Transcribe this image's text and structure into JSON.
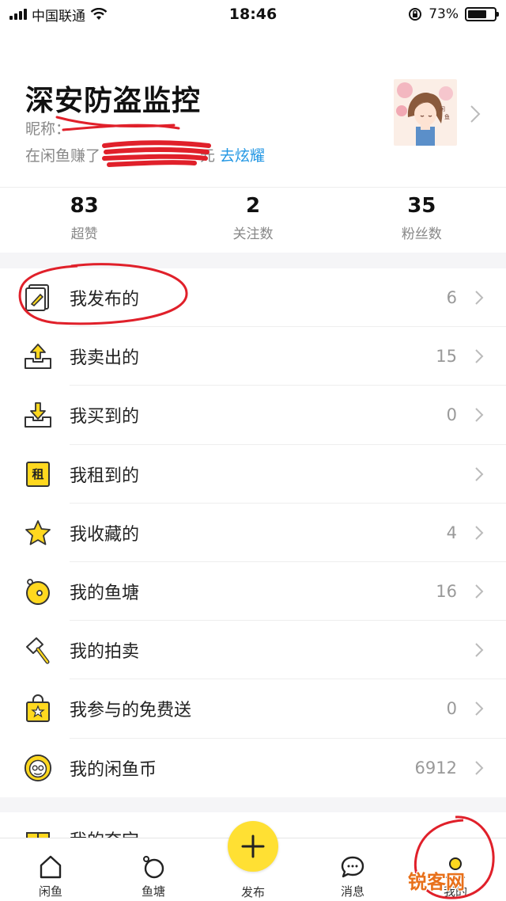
{
  "status_bar": {
    "carrier": "中国联通",
    "time": "18:46",
    "battery": "73%",
    "battery_level": 0.73
  },
  "profile": {
    "name": "深安防盗监控",
    "nickname_label": "昵称：",
    "earn_prefix": "在闲鱼赚了",
    "earn_suffix": "元",
    "show_off_link": "去炫耀"
  },
  "stats": [
    {
      "value": "83",
      "label": "超赞"
    },
    {
      "value": "2",
      "label": "关注数"
    },
    {
      "value": "35",
      "label": "粉丝数"
    }
  ],
  "menu": [
    {
      "label": "我发布的",
      "count": "6",
      "icon": "published-icon"
    },
    {
      "label": "我卖出的",
      "count": "15",
      "icon": "sold-icon"
    },
    {
      "label": "我买到的",
      "count": "0",
      "icon": "bought-icon"
    },
    {
      "label": "我租到的",
      "count": "",
      "icon": "rented-icon",
      "icon_text": "租"
    },
    {
      "label": "我收藏的",
      "count": "4",
      "icon": "star-icon"
    },
    {
      "label": "我的鱼塘",
      "count": "16",
      "icon": "fishpond-icon"
    },
    {
      "label": "我的拍卖",
      "count": "",
      "icon": "auction-gavel-icon"
    },
    {
      "label": "我参与的免费送",
      "count": "0",
      "icon": "free-gift-bag-icon"
    },
    {
      "label": "我的闲鱼币",
      "count": "6912",
      "icon": "xianyu-coin-icon"
    }
  ],
  "menu_partial": {
    "label": "我的夺宝"
  },
  "tabbar": {
    "home": "闲鱼",
    "fishpond": "鱼塘",
    "publish": "发布",
    "messages": "消息",
    "mine": "我的"
  },
  "watermark": "锐客网",
  "colors": {
    "accent_yellow": "#ffe033",
    "link_blue": "#2196e3",
    "annotation_red": "#e0202a"
  }
}
